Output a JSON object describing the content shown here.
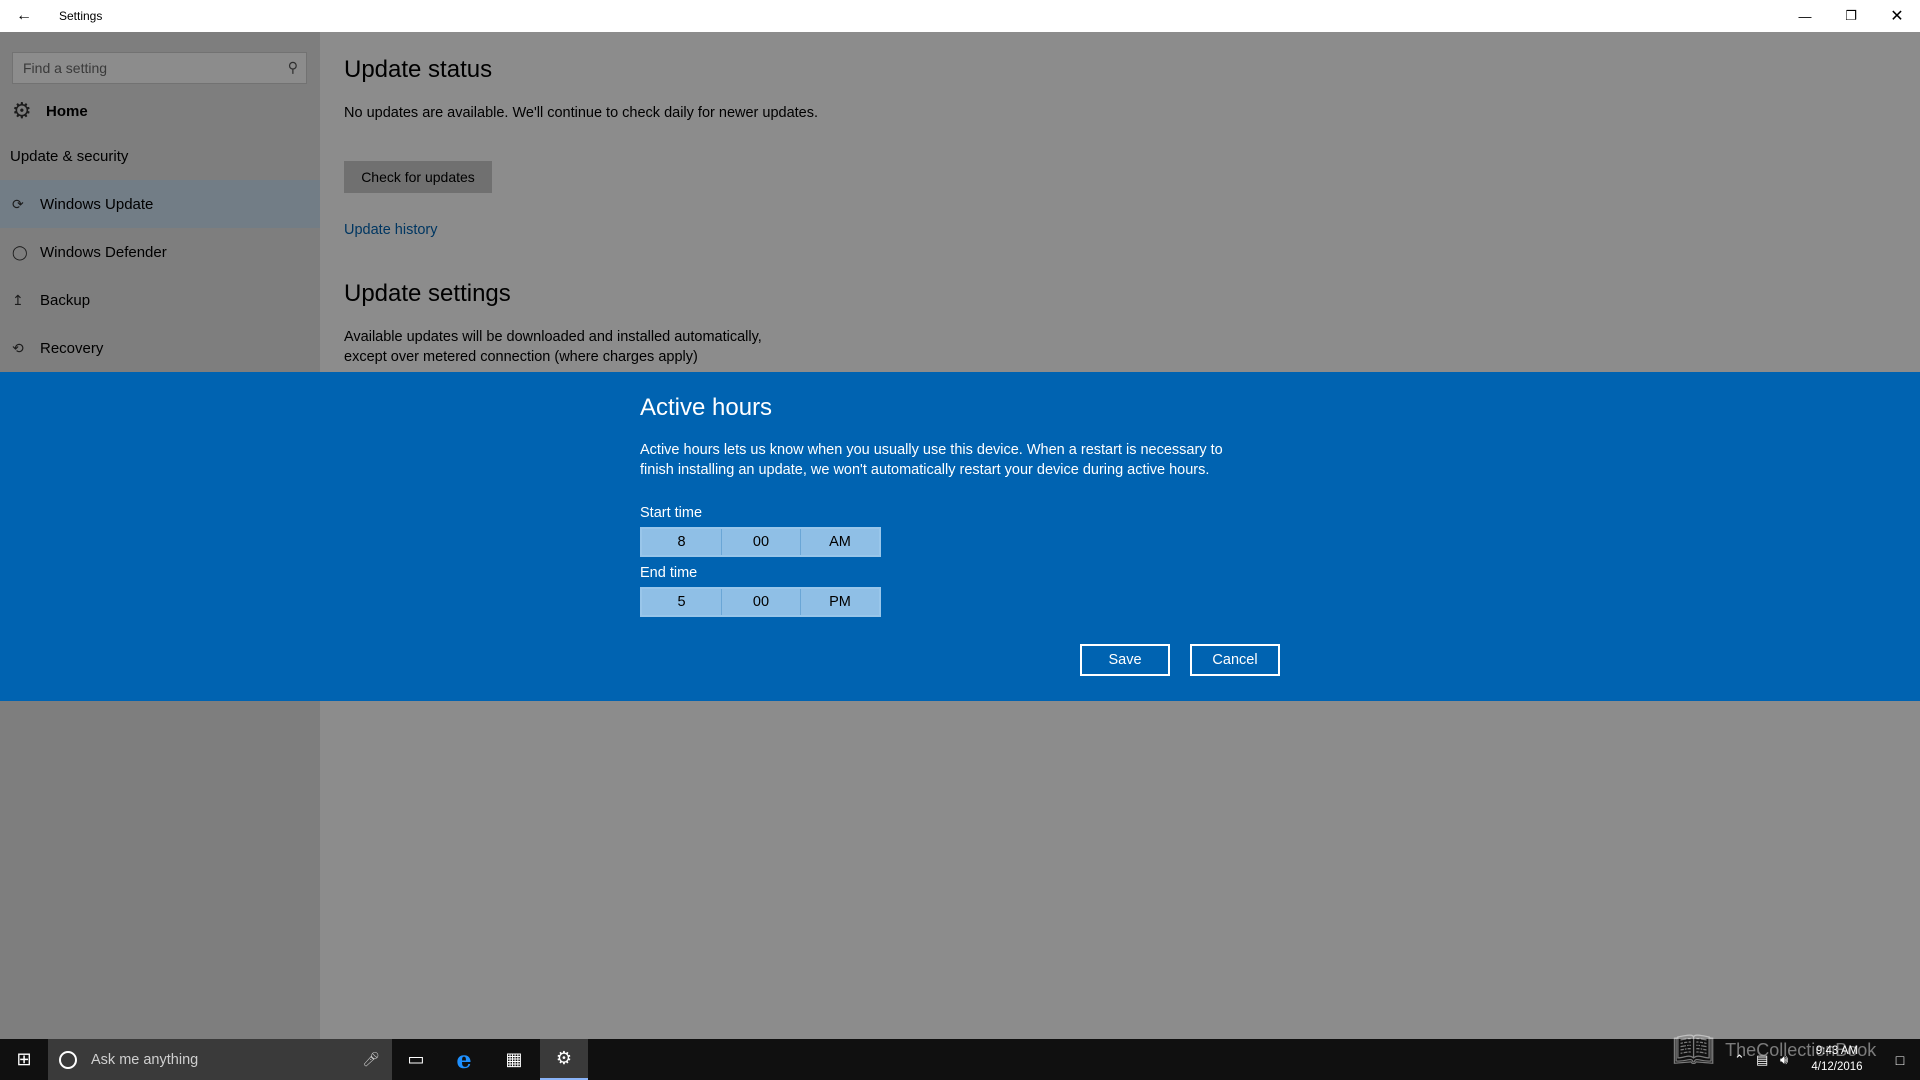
{
  "window": {
    "title": "Settings",
    "back_icon": "arrow-left-icon",
    "controls": {
      "minimize": "—",
      "maximize": "❐",
      "close": "✕"
    }
  },
  "sidebar": {
    "search_placeholder": "Find a setting",
    "home_label": "Home",
    "section_title": "Update & security",
    "items": [
      {
        "label": "Windows Update",
        "icon": "refresh-icon",
        "selected": true
      },
      {
        "label": "Windows Defender",
        "icon": "shield-icon",
        "selected": false
      },
      {
        "label": "Backup",
        "icon": "upload-arrow-icon",
        "selected": false
      },
      {
        "label": "Recovery",
        "icon": "history-icon",
        "selected": false
      }
    ]
  },
  "main": {
    "status_heading": "Update status",
    "status_text": "No updates are available. We'll continue to check daily for newer updates.",
    "check_button": "Check for updates",
    "history_link": "Update history",
    "settings_heading": "Update settings",
    "settings_text_line1": "Available updates will be downloaded and installed automatically,",
    "settings_text_line2": "except over metered connection (where charges apply)"
  },
  "dialog": {
    "title": "Active hours",
    "description": "Active hours lets us know when you usually use this device. When a restart is necessary to finish installing an update, we won't automatically restart your device during active hours.",
    "start_label": "Start time",
    "start": {
      "hour": "8",
      "minute": "00",
      "period": "AM"
    },
    "end_label": "End time",
    "end": {
      "hour": "5",
      "minute": "00",
      "period": "PM"
    },
    "save_label": "Save",
    "cancel_label": "Cancel"
  },
  "taskbar": {
    "search_placeholder": "Ask me anything",
    "time": "9:43 AM",
    "date": "4/12/2016",
    "watermark": "TheCollectionBook"
  },
  "colors": {
    "accent": "#0063b1",
    "selected_nav": "#cfe3f5",
    "taskbar": "#101010"
  }
}
